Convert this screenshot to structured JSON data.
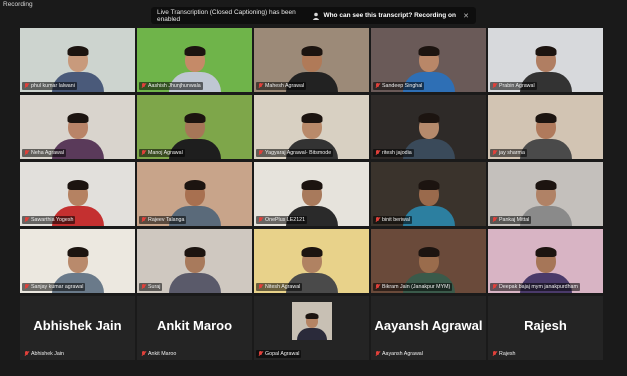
{
  "recording": {
    "label": "Recording"
  },
  "banner": {
    "message": "Live Transcription (Closed Captioning) has been enabled",
    "link": "Who can see this transcript? Recording on",
    "icon": "person-icon",
    "close_icon": "close-icon"
  },
  "participants": [
    {
      "name": "phul kumar lalwani",
      "type": "video",
      "bg": "#cdd4cf",
      "skin": "#c89a7c",
      "shirt": "#4a5a7a",
      "active": true
    },
    {
      "name": "Aashish Jhunjhunwala",
      "type": "video",
      "bg": "#6fb44a",
      "skin": "#c58a68",
      "shirt": "#bfc7d3"
    },
    {
      "name": "Mahesh Agrawal",
      "type": "video",
      "bg": "#9c8a78",
      "skin": "#b07a58",
      "shirt": "#222222"
    },
    {
      "name": "Sandeep Singhal",
      "type": "video",
      "bg": "#6a5a58",
      "skin": "#b98768",
      "shirt": "#2e6fb5"
    },
    {
      "name": "Prabin Agrawal",
      "type": "video",
      "bg": "#d7d9dc",
      "skin": "#b07e62",
      "shirt": "#333333"
    },
    {
      "name": "Neha Agrawal",
      "type": "video",
      "bg": "#d9d4cd",
      "skin": "#b98468",
      "shirt": "#5a3a5a"
    },
    {
      "name": "Manoj Agrawal",
      "type": "video",
      "bg": "#7ea64a",
      "skin": "#a67658",
      "shirt": "#1e1e1e"
    },
    {
      "name": "Yagyaraj Agrawal- Bitsmode",
      "type": "video",
      "bg": "#d8d0c2",
      "skin": "#b98a6a",
      "shirt": "#333333"
    },
    {
      "name": "ritesh jajodia",
      "type": "video",
      "bg": "#2e2a28",
      "skin": "#b58a6c",
      "shirt": "#3a4a5a"
    },
    {
      "name": "jay sharma",
      "type": "video",
      "bg": "#d2c4b3",
      "skin": "#b07a5c",
      "shirt": "#4a4a4a"
    },
    {
      "name": "Sawarthia Yogesh",
      "type": "video",
      "bg": "#e2e0dc",
      "skin": "#b58262",
      "shirt": "#c43030"
    },
    {
      "name": "Rajeev Talanga",
      "type": "video",
      "bg": "#c8a48a",
      "skin": "#a87050",
      "shirt": "#5a6a7a"
    },
    {
      "name": "OnePlus LE2121",
      "type": "video",
      "bg": "#e6e3dc",
      "skin": "#a87a5c",
      "shirt": "#2a2a2a"
    },
    {
      "name": "binit beriwal",
      "type": "video",
      "bg": "#3a332c",
      "skin": "#9a6a4c",
      "shirt": "#2c7fa0"
    },
    {
      "name": "Pankaj Mittal",
      "type": "video",
      "bg": "#c4c0bc",
      "skin": "#b08266",
      "shirt": "#8a8a8a"
    },
    {
      "name": "Sanjay kumar agrawal",
      "type": "video",
      "bg": "#ece8e0",
      "skin": "#b98a6c",
      "shirt": "#6a7a8a"
    },
    {
      "name": "Suraj",
      "type": "video",
      "bg": "#cfc8c0",
      "skin": "#a87a5c",
      "shirt": "#5a5a6a"
    },
    {
      "name": "Nitesh Agrawal",
      "type": "video",
      "bg": "#e8d28a",
      "skin": "#b08262",
      "shirt": "#4a4a4a"
    },
    {
      "name": "Bikram Jain (Janakpur MYM)",
      "type": "video",
      "bg": "#6a4a3a",
      "skin": "#9a6c4c",
      "shirt": "#3a5a4a"
    },
    {
      "name": "Deepak bajaj mym janakpurdham",
      "type": "video",
      "bg": "#d8b4c4",
      "skin": "#a67658",
      "shirt": "#4a3a6a"
    },
    {
      "name": "Abhishek Jain",
      "type": "avatar",
      "display": "Abhishek Jain"
    },
    {
      "name": "Ankit Maroo",
      "type": "avatar",
      "display": "Ankit Maroo"
    },
    {
      "name": "Gopal Agrawal",
      "type": "small",
      "bg": "#c8c0b4",
      "skin": "#b58464",
      "shirt": "#2a2a3a"
    },
    {
      "name": "Aayansh Agrawal",
      "type": "avatar",
      "display": "Aayansh Agrawal"
    },
    {
      "name": "Rajesh",
      "type": "avatar",
      "display": "Rajesh"
    }
  ]
}
